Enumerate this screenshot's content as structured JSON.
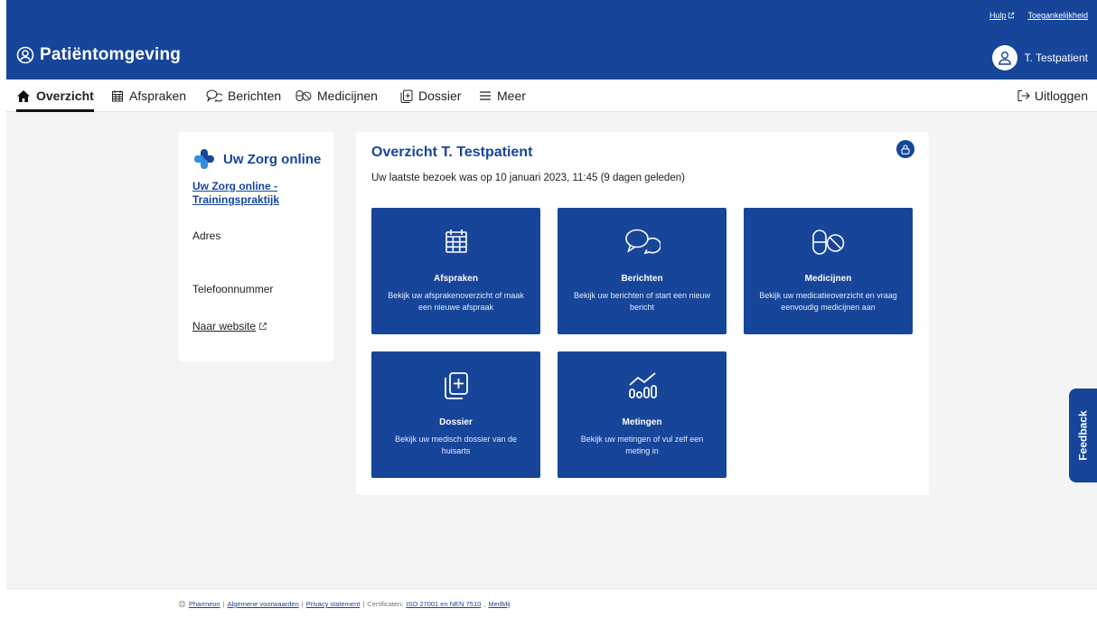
{
  "header": {
    "help_link": "Hulp",
    "accessibility_link": "Toegankelijkheid",
    "app_title": "Patiëntomgeving",
    "user_name": "T. Testpatient"
  },
  "nav": {
    "items": [
      {
        "label": "Overzicht",
        "icon": "home-icon",
        "active": true
      },
      {
        "label": "Afspraken",
        "icon": "calendar-icon"
      },
      {
        "label": "Berichten",
        "icon": "chat-icon"
      },
      {
        "label": "Medicijnen",
        "icon": "pills-icon"
      },
      {
        "label": "Dossier",
        "icon": "dossier-icon"
      },
      {
        "label": "Meer",
        "icon": "menu-icon"
      }
    ],
    "logout": "Uitloggen"
  },
  "practice": {
    "logo_text": "Uw Zorg online",
    "name": "Uw Zorg online - Trainingspraktijk",
    "address_label": "Adres",
    "phone_label": "Telefoonnummer",
    "website_link": "Naar website"
  },
  "overview": {
    "title": "Overzicht T. Testpatient",
    "last_visit": "Uw laatste bezoek was op 10 januari 2023, 11:45 (9 dagen geleden)",
    "tiles": [
      {
        "title": "Afspraken",
        "desc": "Bekijk uw afsprakenoverzicht of maak een nieuwe afspraak",
        "icon": "calendar-icon"
      },
      {
        "title": "Berichten",
        "desc": "Bekijk uw berichten of start een nieuw bericht",
        "icon": "chat-icon"
      },
      {
        "title": "Medicijnen",
        "desc": "Bekijk uw medicatieoverzicht en vraag eenvoudig medicijnen aan",
        "icon": "pills-icon"
      },
      {
        "title": "Dossier",
        "desc": "Bekijk uw medisch dossier van de huisarts",
        "icon": "dossier-icon"
      },
      {
        "title": "Metingen",
        "desc": "Bekijk uw metingen of vul zelf een meting in",
        "icon": "measurements-icon"
      }
    ]
  },
  "feedback": "Feedback",
  "footer": {
    "pharmeon": "Pharmeon",
    "terms": "Algemene voorwaarden",
    "privacy": "Privacy statement",
    "cert_label": "Certificaten:",
    "iso": "ISO 27001 en NEN 7510",
    "medmij": "MedMij"
  },
  "colors": {
    "brand_blue": "#16459a",
    "page_bg": "#f4f4f4"
  }
}
